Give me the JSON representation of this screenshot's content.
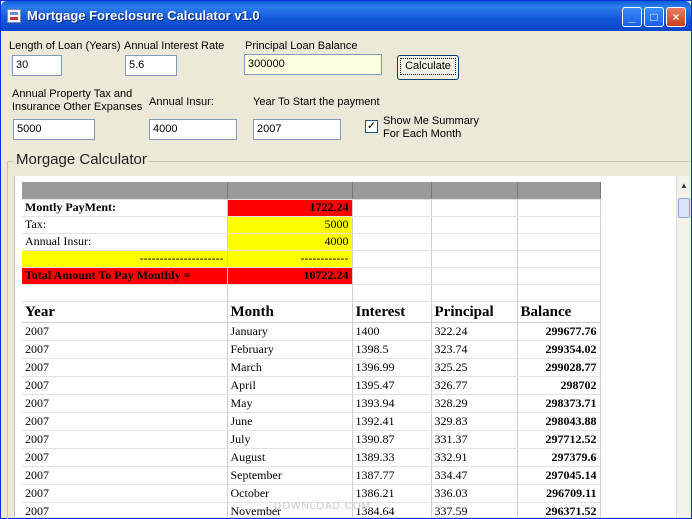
{
  "window": {
    "title": "Mortgage Foreclosure Calculator v1.0"
  },
  "form": {
    "loan_length": {
      "label": "Length of Loan (Years)",
      "value": "30"
    },
    "interest_rate": {
      "label": "Annual Interest Rate",
      "value": "5.6"
    },
    "principal": {
      "label": "Principal Loan Balance",
      "value": "300000"
    },
    "calculate_label": "Calculate",
    "property_tax": {
      "label_line1": "Annual Property Tax and",
      "label_line2": "Insurance Other Expanses",
      "value": "5000"
    },
    "annual_insur": {
      "label": "Annual Insur:",
      "value": "4000"
    },
    "start_year": {
      "label": "Year To Start the payment",
      "value": "2007"
    },
    "summary_checkbox": {
      "label_line1": "Show Me Summary",
      "label_line2": "For Each Month",
      "checked": true,
      "mark": "✓"
    }
  },
  "group": {
    "legend": "Morgage Calculator"
  },
  "summary": {
    "monthly_payment": {
      "label": "Montly PayMent:",
      "value": "1722.24"
    },
    "tax": {
      "label": "Tax:",
      "value": "5000"
    },
    "insur": {
      "label": "Annual Insur:",
      "value": "4000"
    },
    "separator_left": "---------------------",
    "separator_right": "------------",
    "total": {
      "label": "Total Amount To Pay Monthly =",
      "value": "10722.24"
    }
  },
  "schedule": {
    "headers": [
      "Year",
      "Month",
      "Interest",
      "Principal",
      "Balance"
    ],
    "rows": [
      [
        "2007",
        "January",
        "1400",
        "322.24",
        "299677.76"
      ],
      [
        "2007",
        "February",
        "1398.5",
        "323.74",
        "299354.02"
      ],
      [
        "2007",
        "March",
        "1396.99",
        "325.25",
        "299028.77"
      ],
      [
        "2007",
        "April",
        "1395.47",
        "326.77",
        "298702"
      ],
      [
        "2007",
        "May",
        "1393.94",
        "328.29",
        "298373.71"
      ],
      [
        "2007",
        "June",
        "1392.41",
        "329.83",
        "298043.88"
      ],
      [
        "2007",
        "July",
        "1390.87",
        "331.37",
        "297712.52"
      ],
      [
        "2007",
        "August",
        "1389.33",
        "332.91",
        "297379.6"
      ],
      [
        "2007",
        "September",
        "1387.77",
        "334.47",
        "297045.14"
      ],
      [
        "2007",
        "October",
        "1386.21",
        "336.03",
        "296709.11"
      ],
      [
        "2007",
        "November",
        "1384.64",
        "337.59",
        "296371.52"
      ]
    ]
  },
  "watermark": "DOWNLOAD.COM"
}
